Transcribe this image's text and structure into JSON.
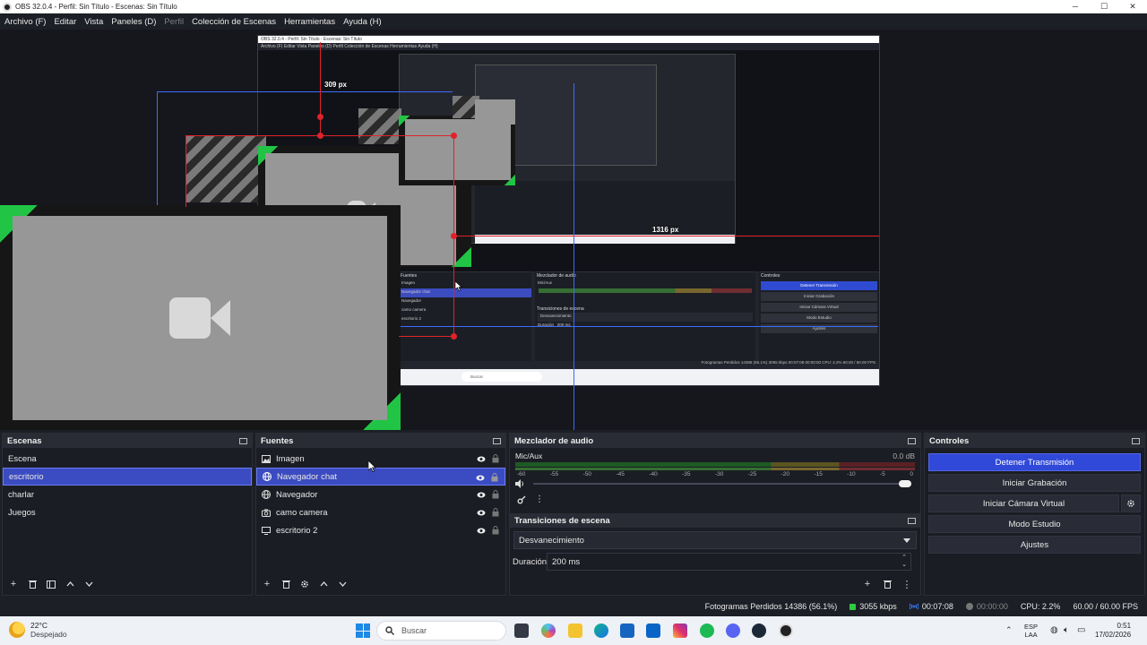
{
  "window": {
    "title": "OBS 32.0.4 - Perfil: Sin Título - Escenas: Sin Título",
    "controls": [
      "─",
      "☐",
      "✕"
    ]
  },
  "menu": [
    {
      "label": "Archivo (F)",
      "enabled": true
    },
    {
      "label": "Editar",
      "enabled": true
    },
    {
      "label": "Vista",
      "enabled": true
    },
    {
      "label": "Paneles (D)",
      "enabled": true
    },
    {
      "label": "Perfil",
      "enabled": false
    },
    {
      "label": "Colección de Escenas",
      "enabled": true
    },
    {
      "label": "Herramientas",
      "enabled": true
    },
    {
      "label": "Ayuda (H)",
      "enabled": true
    }
  ],
  "preview": {
    "label_309": "309 px",
    "label_1316": "1316 px"
  },
  "nested": {
    "title": "OBS 32.0.4 - Perfil: Sin Título - Escenas: Sin Título",
    "menu": "Archivo (F)   Editar   Vista   Paneles (D)   Perfil   Colección de Escenas   Herramientas   Ayuda (H)",
    "sources_title": "Fuentes",
    "sources": [
      "Imagen",
      "Navegador chat",
      "Navegador",
      "camo camera",
      "escritorio 2"
    ],
    "mixer_title": "Mezclador de audio",
    "mixer_channel": "Mic/Aux",
    "transitions_title": "Transiciones de escena",
    "transition_value": "Desvanecimiento",
    "duration_label": "Duración",
    "duration_value": "200 ms",
    "controls_title": "Controles",
    "controls": [
      "Detener Transmisión",
      "Iniciar Grabación",
      "Iniciar Cámara Virtual",
      "Modo Estudio",
      "Ajustes"
    ],
    "status": "Fotogramas Perdidos 14386 (56.1%)   3055 kbps   00:07:08   00:00:00   CPU: 2.2%   60.00 / 60.00 FPS",
    "search": "Buscar"
  },
  "docks": {
    "scenes": {
      "title": "Escenas",
      "items": [
        "Escena",
        "escritorio",
        "charlar",
        "Juegos"
      ],
      "selected_index": 1
    },
    "sources": {
      "title": "Fuentes",
      "items": [
        {
          "label": "Imagen",
          "icon": "image-icon"
        },
        {
          "label": "Navegador chat",
          "icon": "globe-icon"
        },
        {
          "label": "Navegador",
          "icon": "globe-icon"
        },
        {
          "label": "camo camera",
          "icon": "camera-icon"
        },
        {
          "label": "escritorio 2",
          "icon": "monitor-icon"
        }
      ],
      "selected_index": 1
    },
    "mixer": {
      "title": "Mezclador de audio",
      "channel_name": "Mic/Aux",
      "channel_db": "0.0 dB",
      "ticks": [
        "-60",
        "-55",
        "-50",
        "-45",
        "-40",
        "-35",
        "-30",
        "-25",
        "-20",
        "-15",
        "-10",
        "-5",
        "0"
      ],
      "volume_level": 1.0
    },
    "transitions": {
      "title": "Transiciones de escena",
      "value": "Desvanecimiento",
      "duration_label": "Duración",
      "duration_value": "200 ms"
    },
    "controls": {
      "title": "Controles",
      "buttons": [
        {
          "label": "Detener Transmisión",
          "active": true
        },
        {
          "label": "Iniciar Grabación",
          "active": false
        },
        {
          "label": "Iniciar Cámara Virtual",
          "active": false
        },
        {
          "label": "Modo Estudio",
          "active": false
        },
        {
          "label": "Ajustes",
          "active": false
        }
      ]
    }
  },
  "status": {
    "dropped_frames": "Fotogramas Perdidos 14386 (56.1%)",
    "bitrate": "3055 kbps",
    "stream_time": "00:07:08",
    "record_time": "00:00:00",
    "cpu": "CPU: 2.2%",
    "fps": "60.00 / 60.00 FPS"
  },
  "taskbar": {
    "weather_temp": "22°C",
    "weather_desc": "Despejado",
    "search_placeholder": "Buscar",
    "language": "ESP",
    "language_sub": "LAA",
    "time": "0:51",
    "date": "17/02/2026"
  },
  "colors": {
    "accent": "#3b4bc1",
    "active_button": "#3049d8",
    "selection_red": "#e0222a",
    "guide_blue": "#3b6cff",
    "frame_green": "#22d84a"
  }
}
